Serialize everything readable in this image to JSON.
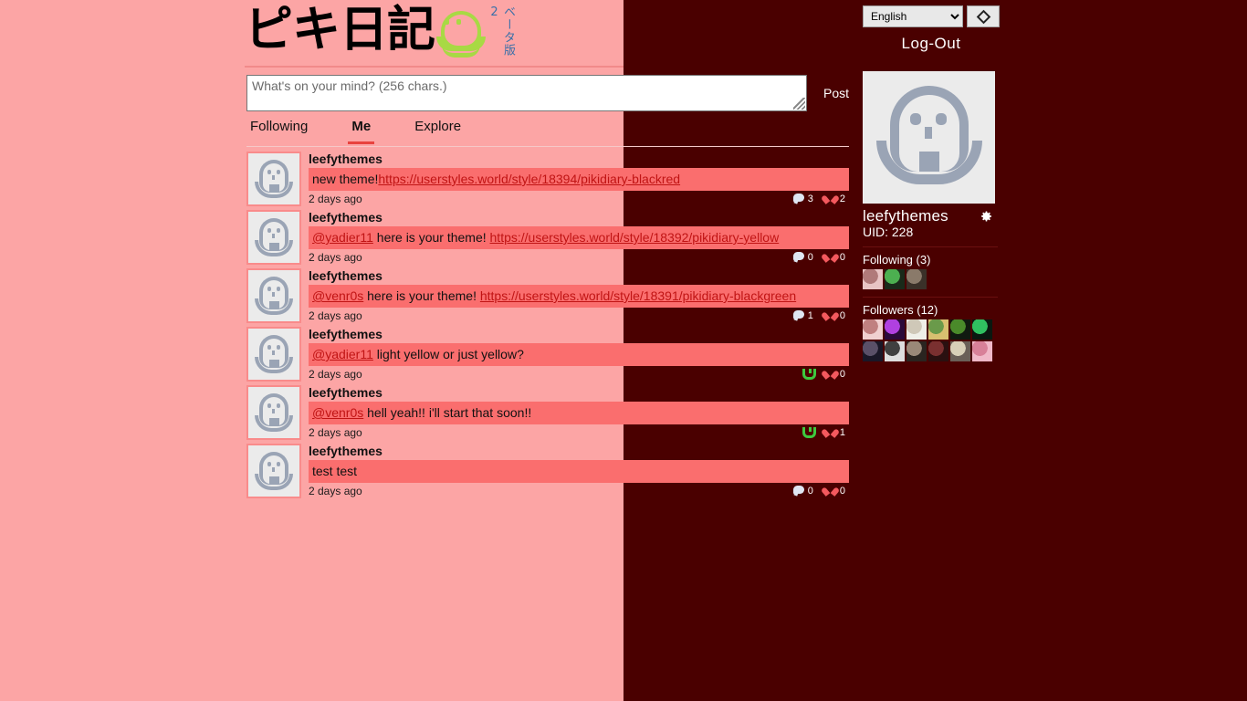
{
  "site": {
    "logo_text": "ピキ日記",
    "logo_beta": "ベータ版2",
    "logo_mark": "pikmin-face-icon"
  },
  "topbar": {
    "language_value": "English",
    "language_options": [
      "English"
    ],
    "theme_toggle_icon": "diamond-icon",
    "logout_label": "Log-Out"
  },
  "compose": {
    "placeholder": "What's on your mind? (256 chars.)",
    "value": "",
    "post_label": "Post",
    "resize_handle": "resize-grip-icon"
  },
  "tabs": [
    {
      "label": "Following",
      "active": false
    },
    {
      "label": "Me",
      "active": true
    },
    {
      "label": "Explore",
      "active": false
    }
  ],
  "feed": {
    "posts": [
      {
        "user": "leefythemes",
        "segments": [
          {
            "type": "text",
            "text": "new theme!"
          },
          {
            "type": "link",
            "text": "https://userstyles.world/style/18394/pikidiary-blackred"
          }
        ],
        "time": "2 days ago",
        "action_icon": "comment-bubble-icon",
        "comments": "3",
        "likes": "2"
      },
      {
        "user": "leefythemes",
        "segments": [
          {
            "type": "mention",
            "text": "@yadier11"
          },
          {
            "type": "text",
            "text": " here is your theme! "
          },
          {
            "type": "link",
            "text": "https://userstyles.world/style/18392/pikidiary-yellow"
          }
        ],
        "time": "2 days ago",
        "action_icon": "comment-bubble-icon",
        "comments": "0",
        "likes": "0"
      },
      {
        "user": "leefythemes",
        "segments": [
          {
            "type": "mention",
            "text": "@venr0s"
          },
          {
            "type": "text",
            "text": " here is your theme! "
          },
          {
            "type": "link",
            "text": "https://userstyles.world/style/18391/pikidiary-blackgreen"
          }
        ],
        "time": "2 days ago",
        "action_icon": "comment-bubble-icon",
        "comments": "1",
        "likes": "0"
      },
      {
        "user": "leefythemes",
        "segments": [
          {
            "type": "mention",
            "text": "@yadier11"
          },
          {
            "type": "text",
            "text": " light yellow or just yellow?"
          }
        ],
        "time": "2 days ago",
        "action_icon": "reply-arrow-icon",
        "comments": "",
        "likes": "0"
      },
      {
        "user": "leefythemes",
        "segments": [
          {
            "type": "mention",
            "text": "@venr0s"
          },
          {
            "type": "text",
            "text": " hell yeah!! i'll start that soon!!"
          }
        ],
        "time": "2 days ago",
        "action_icon": "reply-arrow-icon",
        "comments": "",
        "likes": "1"
      },
      {
        "user": "leefythemes",
        "segments": [
          {
            "type": "text",
            "text": "test test"
          }
        ],
        "time": "2 days ago",
        "action_icon": "comment-bubble-icon",
        "comments": "0",
        "likes": "0"
      }
    ]
  },
  "sidebar": {
    "avatar_icon": "default-pikmin-avatar",
    "username": "leefythemes",
    "settings_icon": "gear-icon",
    "uid_label": "UID: 228",
    "following_label": "Following (3)",
    "following_avatars": [
      {
        "name": "following-avatar-1",
        "color1": "#e8c4c4",
        "color2": "#b07a7a"
      },
      {
        "name": "following-avatar-2",
        "color1": "#1a2a1a",
        "color2": "#4caf50"
      },
      {
        "name": "following-avatar-3",
        "color1": "#3a3028",
        "color2": "#8a7a6a"
      }
    ],
    "followers_label": "Followers (12)",
    "followers_avatars": [
      {
        "name": "follower-avatar-1",
        "color1": "#f0d0d0",
        "color2": "#c08080"
      },
      {
        "name": "follower-avatar-2",
        "color1": "#2a0a3a",
        "color2": "#b040e0"
      },
      {
        "name": "follower-avatar-3",
        "color1": "#efefe8",
        "color2": "#cfc8b8"
      },
      {
        "name": "follower-avatar-4",
        "color1": "#d8c070",
        "color2": "#6a9a4a"
      },
      {
        "name": "follower-avatar-5",
        "color1": "#101a10",
        "color2": "#4a8a2a"
      },
      {
        "name": "follower-avatar-6",
        "color1": "#0a1810",
        "color2": "#30c060"
      },
      {
        "name": "follower-avatar-7",
        "color1": "#1a1828",
        "color2": "#5a5068"
      },
      {
        "name": "follower-avatar-8",
        "color1": "#dedede",
        "color2": "#404040"
      },
      {
        "name": "follower-avatar-9",
        "color1": "#2a2420",
        "color2": "#9a8878"
      },
      {
        "name": "follower-avatar-10",
        "color1": "#2a1010",
        "color2": "#7a3030"
      },
      {
        "name": "follower-avatar-11",
        "color1": "#6a6058",
        "color2": "#d8d0b8"
      },
      {
        "name": "follower-avatar-12",
        "color1": "#f0b8c8",
        "color2": "#d88098"
      }
    ]
  },
  "theme": {
    "page_bg": "#fca5a5",
    "dark_bg": "#4a0000",
    "post_body_bg": "#fa6e6e",
    "accent": "#e8433f",
    "link": "#c01414",
    "logo_green": "#a8d944"
  }
}
